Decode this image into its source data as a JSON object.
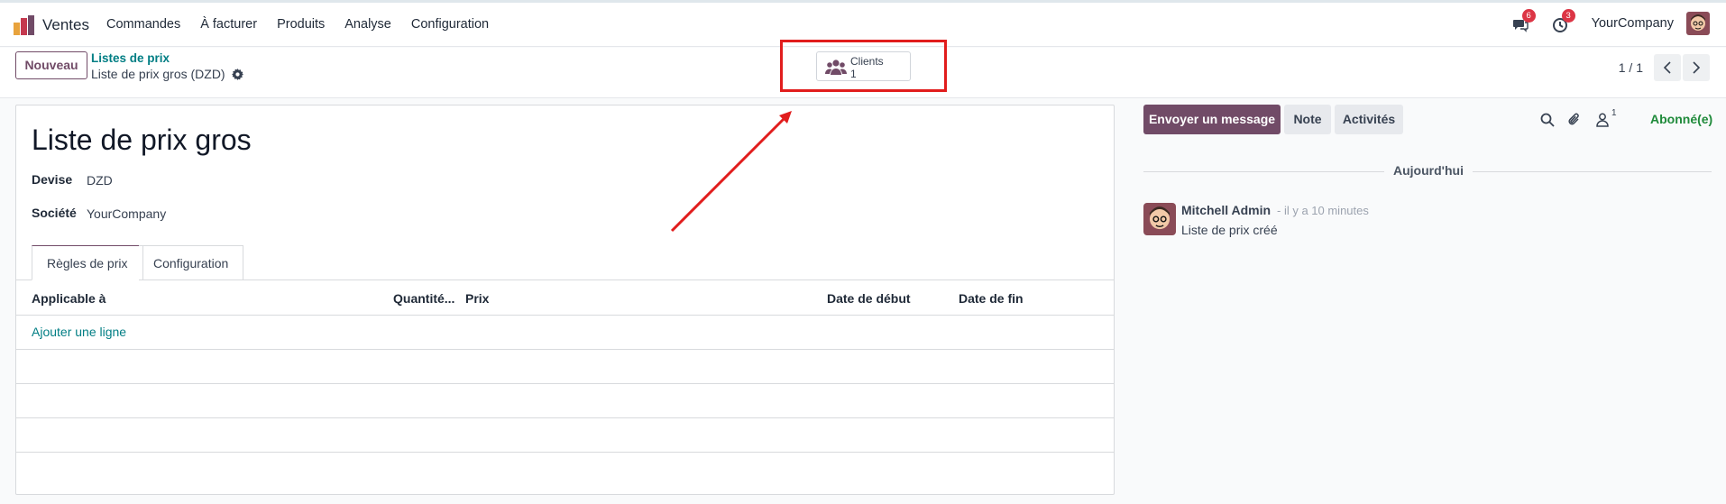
{
  "nav": {
    "app_name": "Ventes",
    "menu": [
      "Commandes",
      "À facturer",
      "Produits",
      "Analyse",
      "Configuration"
    ],
    "messages_badge": "6",
    "activities_badge": "3",
    "company": "YourCompany"
  },
  "control": {
    "new_button": "Nouveau",
    "breadcrumb_parent": "Listes de prix",
    "breadcrumb_current": "Liste de prix gros (DZD)",
    "smart_button_label": "Clients",
    "smart_button_count": "1",
    "pager_value": "1 / 1"
  },
  "form": {
    "title": "Liste de prix gros",
    "currency_label": "Devise",
    "currency_value": "DZD",
    "company_label": "Société",
    "company_value": "YourCompany",
    "tabs": [
      "Règles de prix",
      "Configuration"
    ],
    "columns": [
      "Applicable à",
      "Quantité...",
      "Prix",
      "Date de début",
      "Date de fin"
    ],
    "add_line": "Ajouter une ligne"
  },
  "chatter": {
    "send_message": "Envoyer un message",
    "note": "Note",
    "activities": "Activités",
    "followers_count": "1",
    "subscribed": "Abonné(e)",
    "day_label": "Aujourd'hui",
    "message": {
      "author": "Mitchell Admin",
      "date": "- il y a 10 minutes",
      "body": "Liste de prix créé"
    }
  },
  "colors": {
    "brand": "#714b67",
    "link": "#017e84",
    "annotation": "#e11d1d",
    "subscribed": "#1f8a3a"
  }
}
